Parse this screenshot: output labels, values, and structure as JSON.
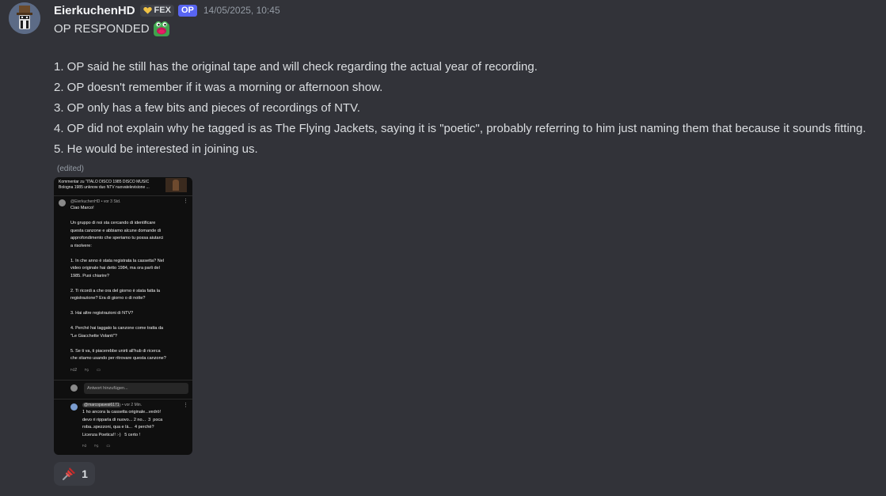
{
  "message": {
    "username": "EierkuchenHD",
    "server_tag": "FEX",
    "op_tag": "OP",
    "timestamp": "14/05/2025, 10:45",
    "first_line": "OP RESPONDED",
    "items": [
      "1. OP said he still has the original tape and will check regarding the actual year of recording.",
      "2. OP doesn't remember if it was a morning or afternoon show.",
      "3. OP only has a few bits and pieces of recordings of NTV.",
      "4. OP did not explain why he tagged is as The Flying Jackets, saying it is \"poetic\", probably referring to him just naming them that because it sounds fitting.",
      "5. He would be interested in joining us."
    ],
    "edited": "(edited)"
  },
  "screenshot": {
    "header_line1": "Kommentar zu \"ITALO DISCO 1985 DISCO MUSIC",
    "header_line2": "Bologna 1985 unknow duo  NTV nuovatelevisione ...",
    "comment1_meta": "@EierkuchenHD • vor 3 Std.",
    "comment1_text": "Ciao Marco!\n\nUn gruppo di noi sta cercando di identificare\nquesta canzone e abbiamo alcune domande di\napprofondimento che speriamo tu possa aiutarci\na risolvere:\n\n1. In che anno è stata registrata la cassetta? Nel\nvideo originale hai detto 1984, ma ora parli del\n1985. Puoi chiarire?\n\n2. Ti ricordi a che ora del giorno è stata fatta la\nregistrazione? Era di giorno o di notte?\n\n3. Hai altre registrazioni di NTV?\n\n4. Perché hai taggato la canzone come tratta da\n\"Le Giacchette Volanti\"?\n\n5. Se ti va, ti piacerebbe unirti all'hub di ricerca\nche stiamo usando per ritrovare questa canzone?",
    "comment1_likes": "2",
    "reply_placeholder": "Antwort hinzufügen...",
    "comment2_handle": "@marcopavesi6171",
    "comment2_time": "• vor 2 Min.",
    "comment2_text": "1 ho ancora la cassetta originale...vedrò!\ndevo ri ripparla di nuovo... 2 no...  3  poca\nroba..spezzoni, qua e là...  4 perchè?\nLicenza Poetica!! :-)   5 certo !"
  },
  "reaction": {
    "emoji": "pushpin",
    "count": "1"
  },
  "colors": {
    "background": "#323339",
    "text": "#dbdee1",
    "muted": "#949ba4",
    "op_badge": "#5865f2",
    "reaction_bg": "#3a3c43"
  }
}
